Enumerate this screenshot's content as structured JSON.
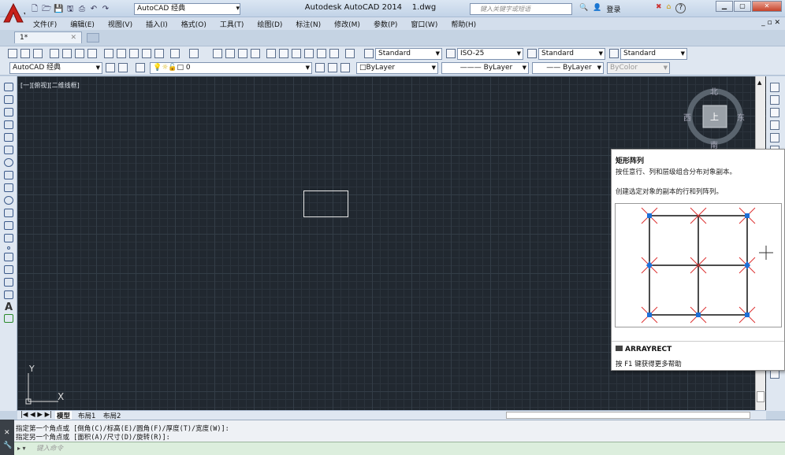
{
  "window": {
    "title": "Autodesk AutoCAD 2014",
    "file": "1.dwg",
    "workspace_top": "AutoCAD 经典",
    "search_placeholder": "键入关键字或短语",
    "login": "登录",
    "help": "?"
  },
  "menu": [
    "文件(F)",
    "编辑(E)",
    "视图(V)",
    "插入(I)",
    "格式(O)",
    "工具(T)",
    "绘图(D)",
    "标注(N)",
    "修改(M)",
    "参数(P)",
    "窗口(W)",
    "帮助(H)"
  ],
  "doc_tab": {
    "label": "1*"
  },
  "styles": {
    "text_style": "Standard",
    "dim_style": "ISO-25",
    "table_style": "Standard",
    "mleader_style": "Standard"
  },
  "toolbar2": {
    "workspace": "AutoCAD 经典",
    "layer": "0",
    "color": "ByLayer",
    "linetype": "ByLayer",
    "lineweight": "ByLayer",
    "plotstyle": "ByColor"
  },
  "canvas": {
    "view_label": "[一][俯视][二维线框]",
    "ucs_y": "Y",
    "ucs_x": "X",
    "background": "#212830"
  },
  "viewcube": {
    "north": "北",
    "south": "南",
    "east": "东",
    "west": "西",
    "top": "上"
  },
  "tooltip": {
    "title": "矩形阵列",
    "desc": "按任意行、列和层级组合分布对象副本。",
    "desc2": "创建选定对象的副本的行和列阵列。",
    "command": "ARRAYRECT",
    "help": "按 F1 键获得更多帮助"
  },
  "layout_tabs": [
    "模型",
    "布局1",
    "布局2"
  ],
  "command": {
    "line1": "指定第一个角点或 [倒角(C)/标高(E)/圆角(F)/厚度(T)/宽度(W)]:",
    "line2": "指定另一个角点或 [面积(A)/尺寸(D)/旋转(R)]:",
    "input_placeholder": "键入命令"
  }
}
